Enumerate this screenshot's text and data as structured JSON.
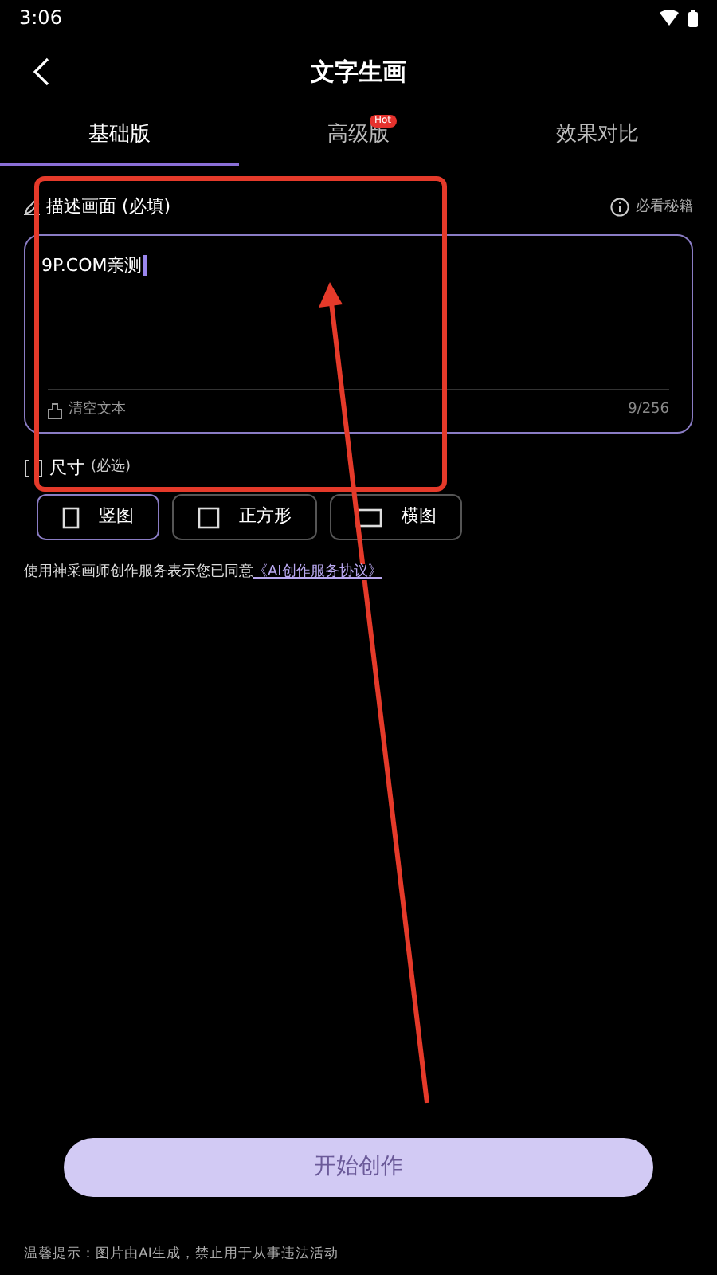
{
  "status_bar": {
    "time": "3:06"
  },
  "header": {
    "title": "文字生画"
  },
  "tabs": [
    {
      "label": "基础版",
      "selected": true
    },
    {
      "label": "高级版",
      "selected": false,
      "badge": "Hot"
    },
    {
      "label": "效果对比",
      "selected": false
    }
  ],
  "prompt": {
    "label": "描述画面 (必填)",
    "help_link": "必看秘籍",
    "value": "9P.COM亲测",
    "clear_button": "清空文本",
    "counter": "9/256"
  },
  "size": {
    "label": "尺寸",
    "hint": "(必选)",
    "options": [
      {
        "label": "竖图",
        "kind": "portrait",
        "selected": true
      },
      {
        "label": "正方形",
        "kind": "square",
        "selected": false
      },
      {
        "label": "横图",
        "kind": "landscape",
        "selected": false
      }
    ]
  },
  "agreement": {
    "text": "使用神采画师创作服务表示您已同意",
    "link": "《AI创作服务协议》"
  },
  "create_button": "开始创作",
  "footer": "温馨提示：图片由AI生成，禁止用于从事违法活动"
}
